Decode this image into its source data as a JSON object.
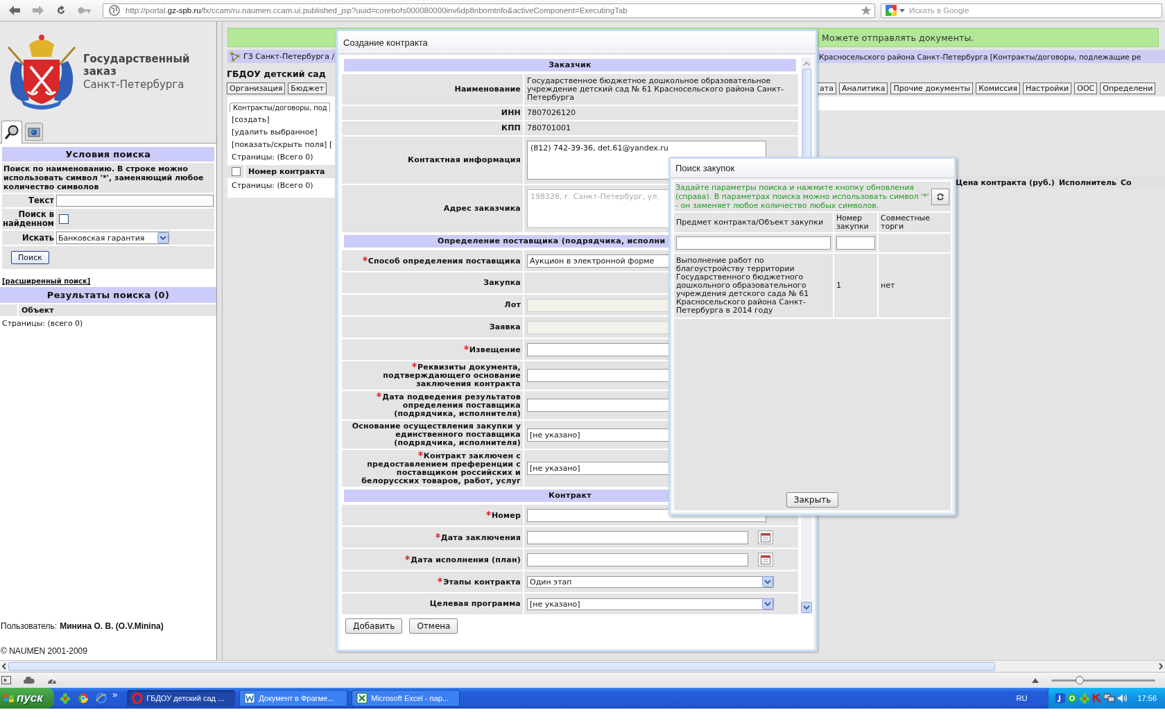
{
  "browser": {
    "url": "http://portal.**gz-spb.ru**/fx/ccam/ru.naumen.ccam.ui.published_jsp?uuid=corebofs000080000inv6dp8nbomtnfo&activeComponent=ExecutingTab",
    "search_placeholder": "Искать в Google"
  },
  "left_panel": {
    "logo": {
      "title": "Государственный заказ",
      "subtitle": "Санкт-Петербурга"
    },
    "tabs": [
      {
        "kind": "search",
        "selected": true
      },
      {
        "kind": "folder",
        "selected": false
      }
    ],
    "search_title": "Условия поиска",
    "hint": "Поиск по наименованию. В строке можно использовать символ '*', заменяющий любое количество символов",
    "text_field": {
      "label": "Текст"
    },
    "search_in_found": {
      "label": "Поиск в найденном",
      "checked": false
    },
    "search_type": {
      "label": "Искать",
      "value": "Банковская гарантия"
    },
    "search_button": "Поиск",
    "advanced_link": "[расширенный поиск]",
    "results_title": "Результаты поиска (0)",
    "results_column": "Объект",
    "pages": "Страницы:  (всего 0)",
    "user_label": "Пользователь:",
    "user_name": "Минина О. В. (O.V.Minina)",
    "copyright": "© NAUMEN 2001-2009"
  },
  "main": {
    "status_message": "Можете отправлять документы.",
    "breadcrumb_left": "ГЗ Санкт-Петербурга /",
    "breadcrumb_right": "Красносельского района Санкт-Петербурга [Контракты/договоры, подлежащие ре",
    "page_title": "ГБДОУ детский сад",
    "tabs_left": [
      "Организация",
      "Бюджет"
    ],
    "tabs_right": [
      "ата",
      "Аналитика",
      "Прочие документы",
      "Комиссия",
      "Настройки",
      "ООС",
      "Определени"
    ],
    "contracts_panel": {
      "tab": "Контракты/договоры, под",
      "actions": [
        "[создать]",
        "[удалить выбранное]",
        "[показать/скрыть поля] ["
      ],
      "pages_top": "Страницы:  (Всего 0)",
      "column": "Номер контракта",
      "select_all_checked": false,
      "pages_bottom": "Страницы:  (Всего 0)"
    },
    "columns": [
      "Цена контракта (руб.)",
      "Исполнитель",
      "Со"
    ]
  },
  "modal": {
    "title": "Создание контракта",
    "sections": [
      {
        "title": "Заказчик",
        "rows": [
          {
            "kind": "text",
            "label": "Наименование",
            "value": "Государственное бюджетное дошкольное образовательное учреждение детский сад № 61 Красносельского района Санкт-Петербурга",
            "required": false
          },
          {
            "kind": "text",
            "label": "ИНН",
            "value": "7807026120",
            "required": false
          },
          {
            "kind": "text",
            "label": "КПП",
            "value": "780701001",
            "required": false
          },
          {
            "kind": "textarea",
            "label": "Контактная информация",
            "value": "(812) 742-39-36, det.61@yandex.ru",
            "required": false,
            "disabled": false
          },
          {
            "kind": "textarea",
            "label": "Адрес заказчика",
            "value": "198328, г. Санкт-Петербург, ул.",
            "required": false,
            "disabled": true
          }
        ]
      },
      {
        "title": "Определение поставщика (подрядчика, исполни",
        "rows": [
          {
            "kind": "input",
            "label": "Способ определения поставщика",
            "value": "Аукцион в электронной форме",
            "required": true,
            "disabled": false
          },
          {
            "kind": "empty",
            "label": "Закупка",
            "required": false
          },
          {
            "kind": "input",
            "label": "Лот",
            "required": false,
            "disabled": true
          },
          {
            "kind": "input",
            "label": "Заявка",
            "required": false,
            "disabled": true
          },
          {
            "kind": "input",
            "label": "Извещение",
            "required": true,
            "disabled": false
          },
          {
            "kind": "input",
            "label": "Реквизиты документа, подтверждающего основание заключения контракта",
            "required": true,
            "disabled": false
          },
          {
            "kind": "input",
            "label": "Дата подведения результатов определения поставщика (подрядчика, исполнителя)",
            "required": true,
            "disabled": false
          },
          {
            "kind": "input",
            "label": "Основание осуществления закупки у единственного поставщика (подрядчика, исполнителя)",
            "value": "[не указано]",
            "required": false,
            "disabled": false
          },
          {
            "kind": "input",
            "label": "Контракт заключен с предоставлением преференции с поставщиком российских и белорусских товаров, работ, услуг",
            "value": "[не указано]",
            "required": true,
            "disabled": false
          }
        ]
      },
      {
        "title": "Контракт",
        "rows": [
          {
            "kind": "input",
            "label": "Номер",
            "required": true,
            "disabled": false
          },
          {
            "kind": "date",
            "label": "Дата заключения",
            "required": true,
            "disabled": false
          },
          {
            "kind": "date",
            "label": "Дата исполнения (план)",
            "required": true,
            "disabled": false
          },
          {
            "kind": "select",
            "label": "Этапы контракта",
            "value": "Один этап",
            "required": true,
            "disabled": false
          },
          {
            "kind": "select",
            "label": "Целевая программа",
            "value": "[не указано]",
            "required": false,
            "disabled": false
          }
        ]
      }
    ],
    "buttons": [
      "Добавить",
      "Отмена"
    ]
  },
  "popup": {
    "title": "Поиск закупок",
    "hint": "Задайте параметры поиска и нажмите кнопку обновления (справа). В параметрах поиска можно использовать символ '*' - он заменяет любое количество любых символов.",
    "columns": [
      "Предмет контракта/Объект закупки",
      "Номер закупки",
      "Совместные торги"
    ],
    "rows": [
      [
        "Выполнение работ по благоустройству территории Государственного бюджетного дошкольного образовательного учреждения детского сада № 61 Красносельского района Санкт-Петербурга в 2014 году",
        "1",
        "нет"
      ]
    ],
    "close_button": "Закрыть"
  },
  "status_bar": {
    "zoom_slider": {
      "level": 0.27
    }
  },
  "taskbar": {
    "start": "пуск",
    "more": "»",
    "tasks": [
      {
        "kind": "browser",
        "label": "ГБДОУ детский сад ...",
        "selected": true
      },
      {
        "kind": "word",
        "label": "Документ в Фрагме...",
        "selected": false
      },
      {
        "kind": "excel",
        "label": "Microsoft Excel - пар...",
        "selected": false
      }
    ],
    "language": "RU",
    "clock": "17:56"
  }
}
